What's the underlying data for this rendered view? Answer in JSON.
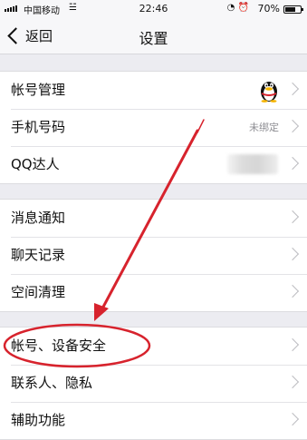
{
  "status_bar": {
    "carrier": "中国移动",
    "wifi": "☱",
    "time": "22:46",
    "icons": "◔ ⏰",
    "battery_text": "70%",
    "battery_level": 0.7
  },
  "nav": {
    "back_label": "返回",
    "title": "设置"
  },
  "groups": [
    {
      "items": [
        {
          "label": "帐号管理",
          "icon": "qq-penguin-icon"
        },
        {
          "label": "手机号码",
          "value": "未绑定"
        },
        {
          "label": "QQ达人",
          "value_blurred": true
        }
      ]
    },
    {
      "items": [
        {
          "label": "消息通知"
        },
        {
          "label": "聊天记录"
        },
        {
          "label": "空间清理"
        }
      ]
    },
    {
      "items": [
        {
          "label": "帐号、设备安全",
          "highlighted": true
        },
        {
          "label": "联系人、隐私"
        },
        {
          "label": "辅助功能"
        }
      ]
    }
  ],
  "colors": {
    "annotation_red": "#d7232d",
    "background": "#ececf1"
  }
}
